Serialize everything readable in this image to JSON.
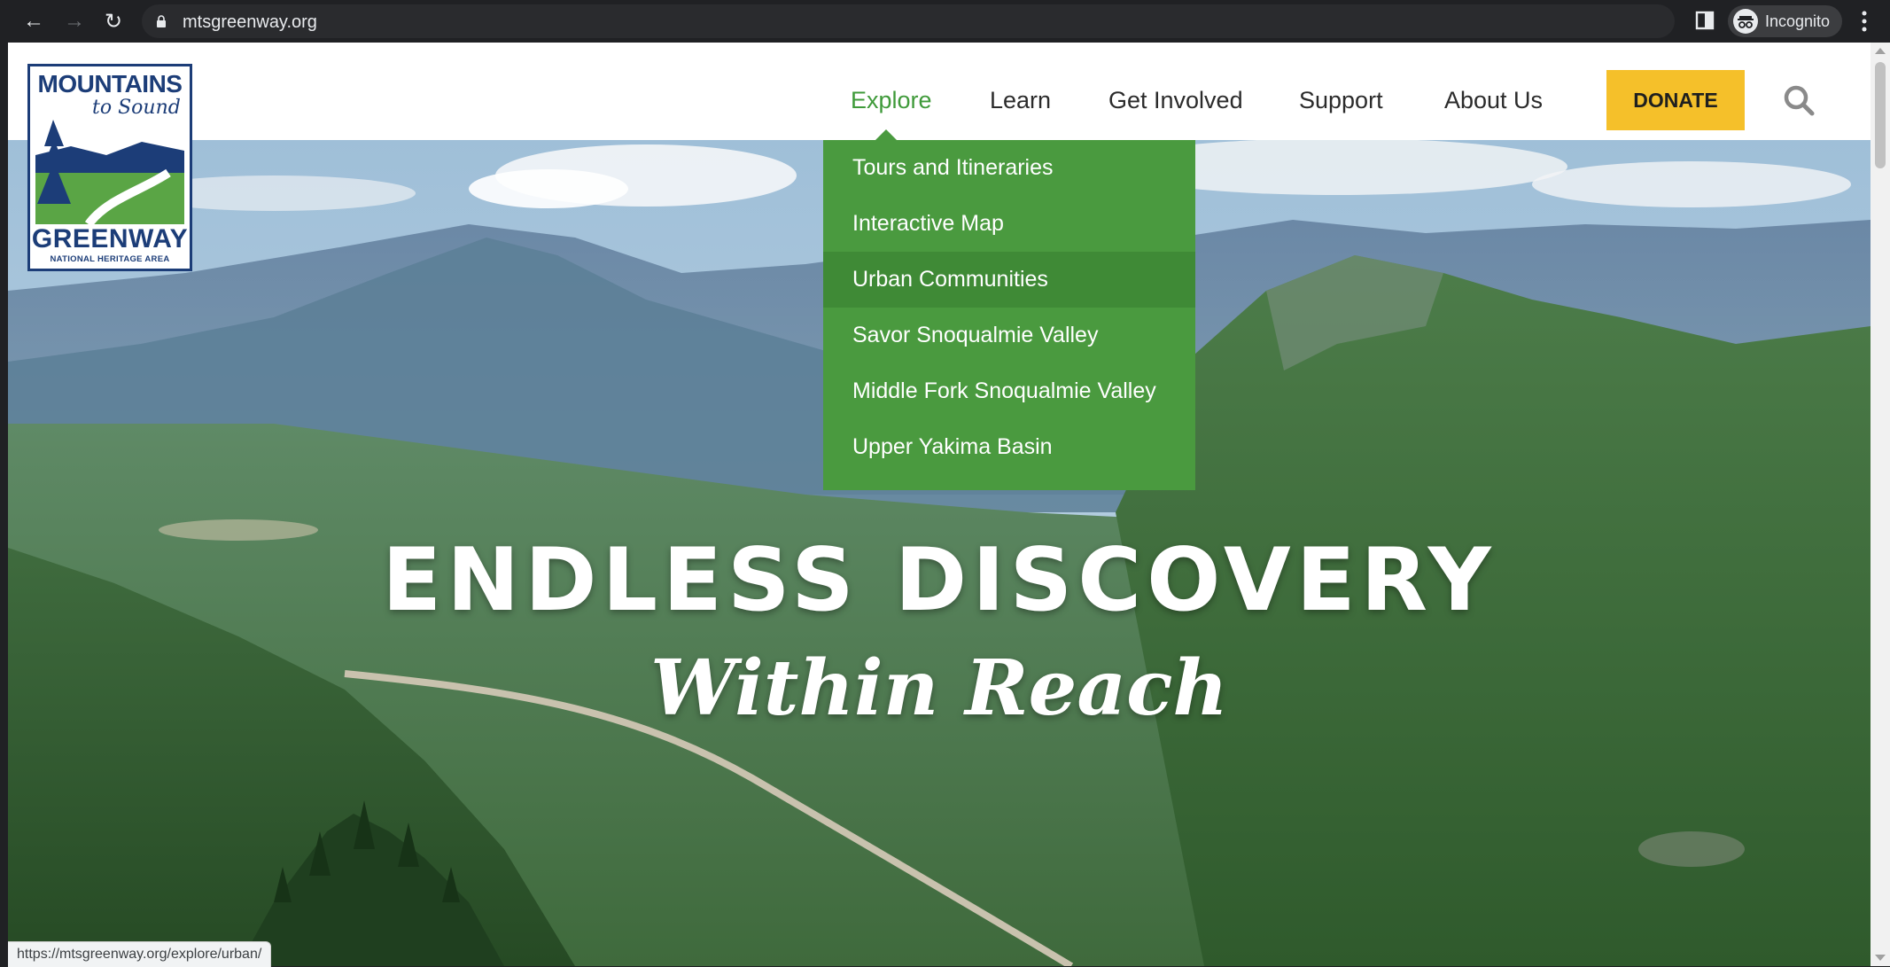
{
  "browser": {
    "url": "mtsgreenway.org",
    "profile_label": "Incognito",
    "status_url": "https://mtsgreenway.org/explore/urban/",
    "icons": {
      "back": "arrow-left-icon",
      "forward": "arrow-right-icon",
      "reload": "reload-icon",
      "lock": "lock-icon",
      "bookmark": "star-icon",
      "side_panel": "side-panel-icon",
      "incognito": "incognito-icon",
      "menu": "kebab-menu-icon"
    }
  },
  "logo": {
    "line1": "MOUNTAINS",
    "line2": "to Sound",
    "line3": "GREENWAY",
    "line4": "NATIONAL HERITAGE AREA"
  },
  "nav": {
    "items": [
      {
        "label": "Explore",
        "active": true
      },
      {
        "label": "Learn",
        "active": false
      },
      {
        "label": "Get Involved",
        "active": false
      },
      {
        "label": "Support",
        "active": false
      },
      {
        "label": "About Us",
        "active": false
      }
    ],
    "donate_label": "DONATE",
    "search_icon": "search-icon"
  },
  "dropdown": {
    "items": [
      {
        "label": "Tours and Itineraries"
      },
      {
        "label": "Interactive Map"
      },
      {
        "label": "Urban Communities",
        "hovered": true
      },
      {
        "label": "Savor Snoqualmie Valley"
      },
      {
        "label": "Middle Fork Snoqualmie Valley"
      },
      {
        "label": "Upper Yakima Basin"
      }
    ]
  },
  "hero": {
    "headline": "ENDLESS DISCOVERY",
    "tagline": "Within Reach"
  },
  "colors": {
    "accent_green": "#4a9a3f",
    "active_nav": "#3f9a3a",
    "donate_yellow": "#f5c02a",
    "logo_blue": "#1c3d78"
  }
}
